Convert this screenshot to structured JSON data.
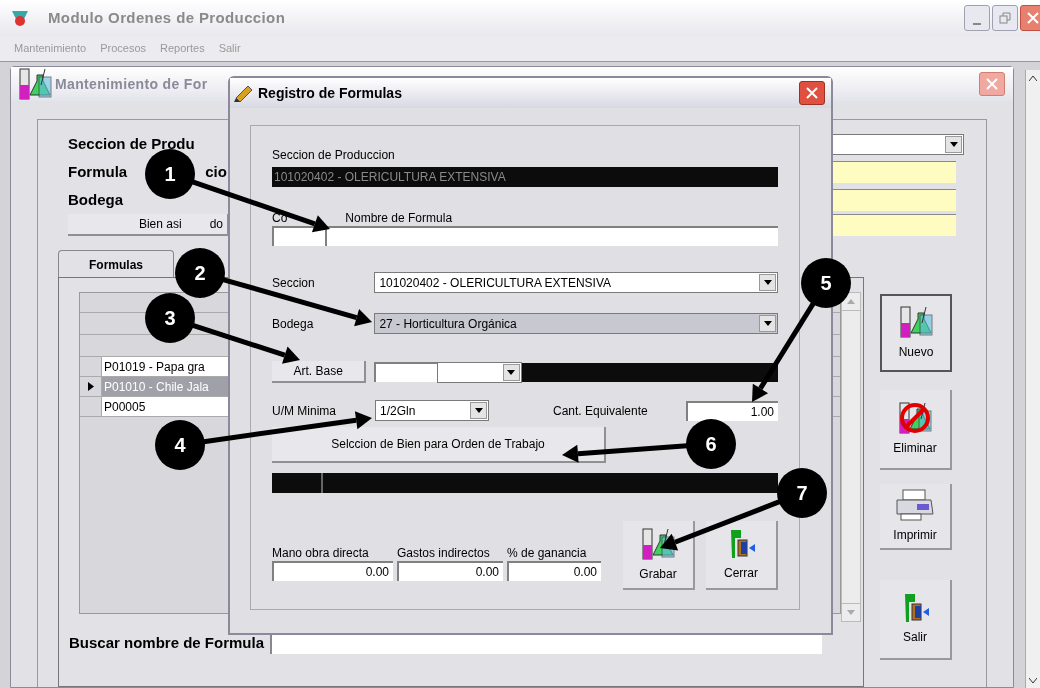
{
  "app": {
    "title": "Modulo Ordenes de Produccion",
    "menu": [
      "Mantenimiento",
      "Procesos",
      "Reportes",
      "Salir"
    ]
  },
  "main_form": {
    "title": "Mantenimiento de For",
    "labels": {
      "seccion": "Seccion de Produ",
      "formula": "Formula",
      "formula_tail": "cio",
      "bodega": "Bodega"
    },
    "assign_button": {
      "head": "Bien asi",
      "tail": "do"
    },
    "tab": "Formulas",
    "grid_rows": [
      {
        "text": "P01019 - Papa gra",
        "selected": false
      },
      {
        "text": "P01010 - Chile Jala",
        "selected": true
      },
      {
        "text": "P00005",
        "selected": false
      }
    ],
    "actions": [
      {
        "label": "Nuevo",
        "kind": "flask",
        "focused": true
      },
      {
        "label": "Eliminar",
        "kind": "flask-no",
        "focused": false
      },
      {
        "label": "Imprimir",
        "kind": "printer",
        "focused": false
      },
      {
        "label": "Salir",
        "kind": "exit",
        "focused": false
      }
    ],
    "search_label": "Buscar nombre de Formula"
  },
  "dialog": {
    "title": "Registro de Formulas",
    "seccion_produccion": {
      "label": "Seccion de Produccion",
      "value": "101020402 - OLERICULTURA EXTENSIVA"
    },
    "codigo_label": "Co",
    "nombre_label": "Nombre de Formula",
    "seccion": {
      "label": "Seccion",
      "value": "101020402 - OLERICULTURA EXTENSIVA"
    },
    "bodega": {
      "label": "Bodega",
      "value": "27 - Horticultura Orgánica"
    },
    "art_base_button": "Art. Base",
    "um": {
      "label": "U/M Minima",
      "value": "1/2Gln"
    },
    "cant": {
      "label": "Cant. Equivalente",
      "value": "1.00"
    },
    "select_button": "Selccion de Bien para Orden de Trabajo",
    "costs": [
      {
        "label": "Mano obra directa",
        "value": "0.00"
      },
      {
        "label": "Gastos indirectos",
        "value": "0.00"
      },
      {
        "label": "% de ganancia",
        "value": "0.00"
      }
    ],
    "buttons": [
      {
        "label": "Grabar",
        "kind": "flask"
      },
      {
        "label": "Cerrar",
        "kind": "exit"
      }
    ]
  },
  "callouts": [
    "1",
    "2",
    "3",
    "4",
    "5",
    "6",
    "7"
  ]
}
